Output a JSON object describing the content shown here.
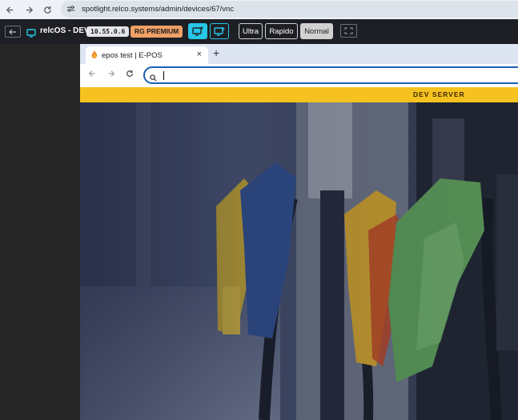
{
  "outer_browser": {
    "url": "spotlight.relco.systems/admin/devices/67/vnc"
  },
  "toolbar": {
    "device_title": "relcOS - DEV",
    "ip_badge": "10.55.0.6",
    "plan_badge": "RG PREMIUM",
    "quality_options": [
      "Ultra",
      "Rapido",
      "Normal"
    ],
    "selected_quality": "Normal",
    "colors": {
      "accent": "#27c6e7",
      "premium": "#f0a066",
      "bar": "#1d1f24"
    }
  },
  "remote_browser": {
    "tab_title": "epos test | E-POS",
    "new_tab_symbol": "+",
    "close_symbol": "×",
    "address_value": "",
    "banner_text": "DEV SERVER",
    "colors": {
      "banner": "#f5c220",
      "address_border": "#1a5fb4"
    }
  }
}
